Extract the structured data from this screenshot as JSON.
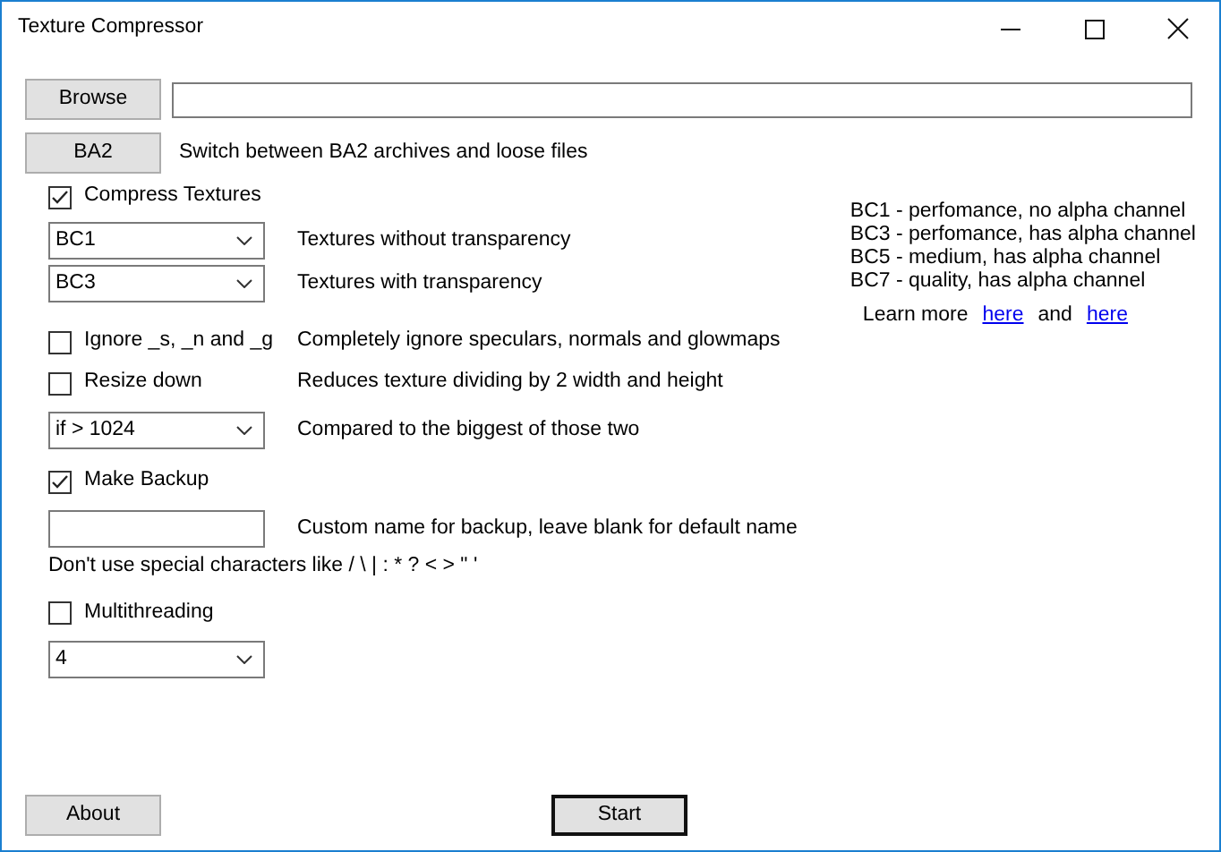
{
  "window": {
    "title": "Texture Compressor"
  },
  "browse": {
    "button": "Browse"
  },
  "ba2": {
    "button": "BA2",
    "description": "Switch between BA2 archives and loose files"
  },
  "compress_textures": {
    "label": "Compress Textures",
    "checked": true
  },
  "formats": [
    {
      "value": "BC1",
      "description": "Textures without transparency"
    },
    {
      "value": "BC3",
      "description": "Textures with transparency"
    }
  ],
  "options": [
    {
      "label": "Ignore _s, _n and _g",
      "checked": false,
      "description": "Completely ignore speculars, normals and glowmaps"
    },
    {
      "label": "Resize down",
      "checked": false,
      "description": "Reduces texture dividing by 2 width and height"
    }
  ],
  "resize_threshold": {
    "value": "if > 1024",
    "description": "Compared to the biggest of those two"
  },
  "make_backup": {
    "label": "Make Backup",
    "checked": true
  },
  "backup_name": {
    "description": "Custom name for backup, leave blank for default name"
  },
  "warning": "Don't use special characters like / \\ | : * ? < > \" '",
  "multithreading": {
    "label": "Multithreading",
    "checked": false
  },
  "threads": {
    "value": "4"
  },
  "info": {
    "lines": [
      "BC1 - perfomance, no alpha channel",
      "BC3 - perfomance, has alpha channel",
      "BC5 - medium, has alpha channel",
      "BC7 - quality, has alpha channel"
    ],
    "learn_more": "Learn more",
    "links": [
      "here",
      "here"
    ],
    "joiner": "and"
  },
  "footer": {
    "about": "About",
    "start": "Start"
  }
}
